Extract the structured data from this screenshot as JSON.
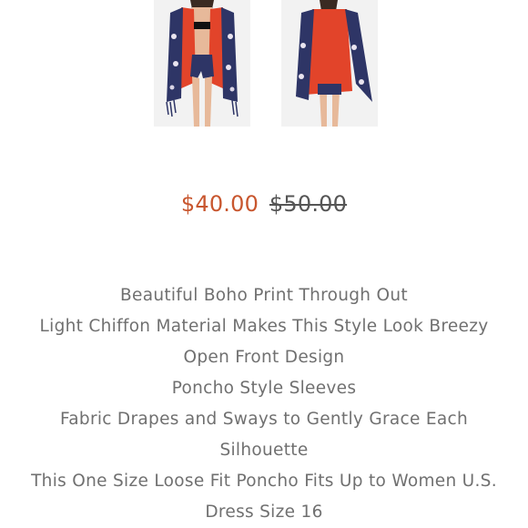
{
  "product": {
    "images": [
      {
        "icon": "model-front-image",
        "view": "front"
      },
      {
        "icon": "model-back-image",
        "view": "back"
      }
    ],
    "price": {
      "sale": "$40.00",
      "original": "$50.00"
    },
    "description": [
      "Beautiful Boho Print Through Out",
      "Light Chiffon Material Makes This Style Look Breezy",
      "Open Front Design",
      "Poncho Style Sleeves",
      "Fabric Drapes and Sways to Gently Grace Each Silhouette",
      "This One Size Loose Fit Poncho Fits Up to Women U.S. Dress Size 16"
    ]
  },
  "colors": {
    "sale_price": "#c8562e",
    "original_price": "#555555",
    "description_text": "#707070",
    "poncho_red": "#e2442a",
    "poncho_navy": "#2e3566"
  }
}
